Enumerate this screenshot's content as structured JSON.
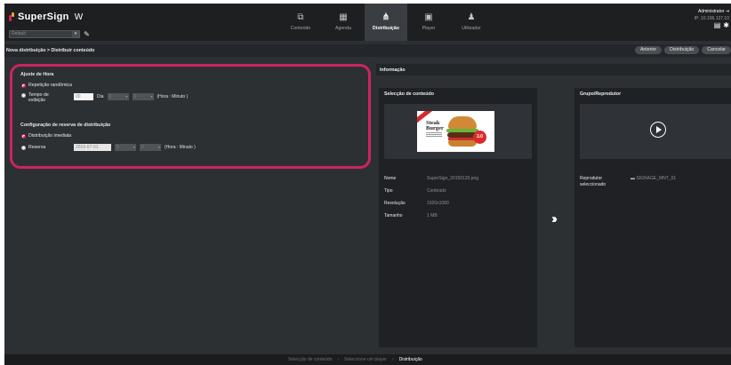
{
  "app": {
    "brand": "SuperSign",
    "edition": "W",
    "group_select_value": "Default"
  },
  "nav": [
    {
      "label": "Conteúdo",
      "icon": "content-icon"
    },
    {
      "label": "Agenda",
      "icon": "calendar-icon"
    },
    {
      "label": "Distribuição",
      "icon": "distribution-icon",
      "active": true
    },
    {
      "label": "Player",
      "icon": "player-icon"
    },
    {
      "label": "Utilizador",
      "icon": "user-icon"
    }
  ],
  "user": {
    "name": "Administrator",
    "ip": "IP: 10.196.127.10"
  },
  "breadcrumb": "Nova distribuição > Distribuir conteúdo",
  "actions": {
    "previous": "Anterior",
    "distribute": "Distribuição",
    "cancel": "Cancelar"
  },
  "time_settings": {
    "title": "Ajuste de Hora",
    "random_label": "Repetição randômica",
    "duration_label": "Tempo de exibição",
    "day_value": "00",
    "day_label": "Dia",
    "hour_value": "0",
    "minute_value": "0",
    "unit_hint": "(Hora : Minuto )"
  },
  "schedule_settings": {
    "title": "Configuração de reserva de distribuição",
    "immediate_label": "Distribuição imediata",
    "reserve_label": "Reserva",
    "date_value": "2016-07-01",
    "hour_value": "0",
    "minute_value": "0",
    "unit_hint": "(Hora : Minuto )"
  },
  "info": {
    "title": "Informação"
  },
  "content_panel": {
    "title": "Selecção de conteúdo",
    "thumb_title_line1": "Steak",
    "thumb_title_line2": "Burger",
    "thumb_price": "3.0",
    "fields": [
      {
        "key": "Nome",
        "value": "SuperSign_20150120.png"
      },
      {
        "key": "Tipo",
        "value": "Conteúdo"
      },
      {
        "key": "Resolução",
        "value": "1920x1080"
      },
      {
        "key": "Tamanho",
        "value": "1 MB"
      }
    ]
  },
  "player_panel": {
    "title": "Grupo/Reprodutor",
    "selected_label": "Reprodutor seleccionado",
    "selected_value": "SIGNAGE_MNT_01"
  },
  "footer_steps": [
    {
      "label": "Selecção de conteúdo"
    },
    {
      "label": "Seleccione um player"
    },
    {
      "label": "Distribuição",
      "current": true
    }
  ]
}
